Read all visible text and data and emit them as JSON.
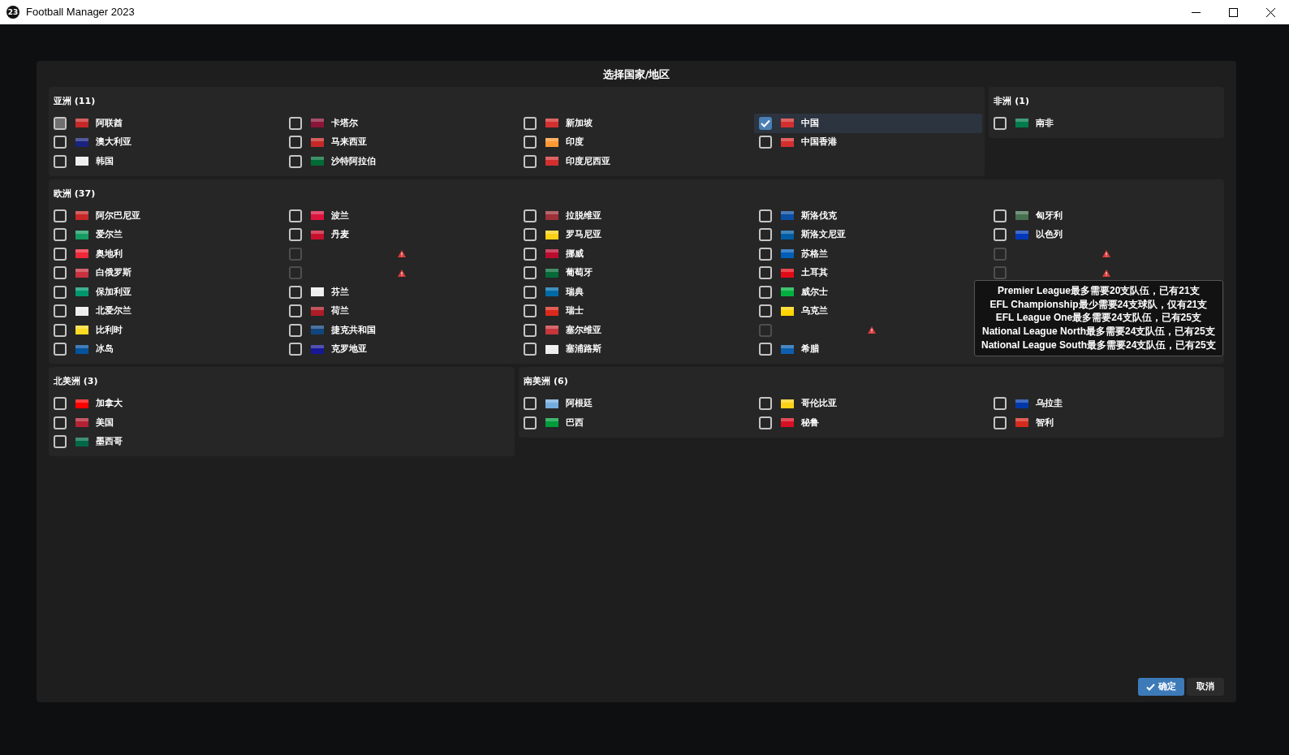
{
  "window": {
    "title": "Football Manager 2023",
    "logo": "23"
  },
  "dialog": {
    "title": "选择国家/地区",
    "rows": [
      [
        {
          "title": "亚洲 (11)",
          "columns": [
            [
              {
                "name": "阿联酋",
                "color": "#c62828",
                "checked": false,
                "hovered": true,
                "disabled": false
              },
              {
                "name": "澳大利亚",
                "color": "#1a237e",
                "checked": false,
                "hovered": false,
                "disabled": false
              },
              {
                "name": "韩国",
                "color": "#eeeeee",
                "checked": false,
                "hovered": false,
                "disabled": false
              }
            ],
            [
              {
                "name": "卡塔尔",
                "color": "#8a1538",
                "checked": false,
                "hovered": false,
                "disabled": false
              },
              {
                "name": "马来西亚",
                "color": "#c62828",
                "checked": false,
                "hovered": false,
                "disabled": false
              },
              {
                "name": "沙特阿拉伯",
                "color": "#006c35",
                "checked": false,
                "hovered": false,
                "disabled": false
              }
            ],
            [
              {
                "name": "新加坡",
                "color": "#d32f2f",
                "checked": false,
                "hovered": false,
                "disabled": false
              },
              {
                "name": "印度",
                "color": "#ff9933",
                "checked": false,
                "hovered": false,
                "disabled": false
              },
              {
                "name": "印度尼西亚",
                "color": "#d32f2f",
                "checked": false,
                "hovered": false,
                "disabled": false
              }
            ],
            [
              {
                "name": "中国",
                "color": "#d32f2f",
                "checked": true,
                "hovered": false,
                "disabled": false
              },
              {
                "name": "中国香港",
                "color": "#d32f2f",
                "checked": false,
                "hovered": false,
                "disabled": false
              }
            ]
          ]
        },
        {
          "title": "非洲 (1)",
          "columns": [
            [
              {
                "name": "南非",
                "color": "#007a4d",
                "checked": false,
                "hovered": false,
                "disabled": false
              }
            ]
          ]
        }
      ],
      [
        {
          "title": "欧洲 (37)",
          "columns": [
            [
              {
                "name": "阿尔巴尼亚",
                "color": "#c62828",
                "checked": false,
                "hovered": false,
                "disabled": false
              },
              {
                "name": "爱尔兰",
                "color": "#169b62",
                "checked": false,
                "hovered": false,
                "disabled": false
              },
              {
                "name": "奥地利",
                "color": "#ed2939",
                "checked": false,
                "hovered": false,
                "disabled": false
              },
              {
                "name": "白俄罗斯",
                "color": "#c8313e",
                "checked": false,
                "hovered": false,
                "disabled": false
              },
              {
                "name": "保加利亚",
                "color": "#00966e",
                "checked": false,
                "hovered": false,
                "disabled": false
              },
              {
                "name": "北爱尔兰",
                "color": "#eeeeee",
                "checked": false,
                "hovered": false,
                "disabled": false
              },
              {
                "name": "比利时",
                "color": "#fdda24",
                "checked": false,
                "hovered": false,
                "disabled": false
              },
              {
                "name": "冰岛",
                "color": "#02529c",
                "checked": false,
                "hovered": false,
                "disabled": false
              }
            ],
            [
              {
                "name": "波兰",
                "color": "#dc143c",
                "checked": false,
                "hovered": false,
                "disabled": false
              },
              {
                "name": "丹麦",
                "color": "#c8102e",
                "checked": false,
                "hovered": false,
                "disabled": false
              },
              {
                "checked": false,
                "hovered": false,
                "disabled": true
              },
              {
                "checked": false,
                "hovered": false,
                "disabled": true
              },
              {
                "name": "芬兰",
                "color": "#eeeeee",
                "checked": false,
                "hovered": false,
                "disabled": false
              },
              {
                "name": "荷兰",
                "color": "#ae1c28",
                "checked": false,
                "hovered": false,
                "disabled": false
              },
              {
                "name": "捷克共和国",
                "color": "#11457e",
                "checked": false,
                "hovered": false,
                "disabled": false
              },
              {
                "name": "克罗地亚",
                "color": "#171796",
                "checked": false,
                "hovered": false,
                "disabled": false
              }
            ],
            [
              {
                "name": "拉脱维亚",
                "color": "#9e3039",
                "checked": false,
                "hovered": false,
                "disabled": false
              },
              {
                "name": "罗马尼亚",
                "color": "#fcd116",
                "checked": false,
                "hovered": false,
                "disabled": false
              },
              {
                "name": "挪威",
                "color": "#ba0c2f",
                "checked": false,
                "hovered": false,
                "disabled": false
              },
              {
                "name": "葡萄牙",
                "color": "#046a38",
                "checked": false,
                "hovered": false,
                "disabled": false
              },
              {
                "name": "瑞典",
                "color": "#006aa7",
                "checked": false,
                "hovered": false,
                "disabled": false
              },
              {
                "name": "瑞士",
                "color": "#da291c",
                "checked": false,
                "hovered": false,
                "disabled": false
              },
              {
                "name": "塞尔维亚",
                "color": "#c6363c",
                "checked": false,
                "hovered": false,
                "disabled": false
              },
              {
                "name": "塞浦路斯",
                "color": "#eeeeee",
                "checked": false,
                "hovered": false,
                "disabled": false
              }
            ],
            [
              {
                "name": "斯洛伐克",
                "color": "#0b4ea2",
                "checked": false,
                "hovered": false,
                "disabled": false
              },
              {
                "name": "斯洛文尼亚",
                "color": "#005da4",
                "checked": false,
                "hovered": false,
                "disabled": false
              },
              {
                "name": "苏格兰",
                "color": "#005eb8",
                "checked": false,
                "hovered": false,
                "disabled": false
              },
              {
                "name": "土耳其",
                "color": "#e30a17",
                "checked": false,
                "hovered": false,
                "disabled": false
              },
              {
                "name": "威尔士",
                "color": "#00b140",
                "checked": false,
                "hovered": false,
                "disabled": false
              },
              {
                "name": "乌克兰",
                "color": "#ffd500",
                "checked": false,
                "hovered": false,
                "disabled": false
              },
              {
                "checked": false,
                "hovered": false,
                "disabled": true
              },
              {
                "name": "希腊",
                "color": "#0d5eaf",
                "checked": false,
                "hovered": false,
                "disabled": false
              }
            ],
            [
              {
                "name": "匈牙利",
                "color": "#477050",
                "checked": false,
                "hovered": false,
                "disabled": false
              },
              {
                "name": "以色列",
                "color": "#0038b8",
                "checked": false,
                "hovered": false,
                "disabled": false
              },
              {
                "checked": false,
                "hovered": false,
                "disabled": true
              },
              {
                "checked": false,
                "hovered": false,
                "disabled": true
              }
            ]
          ]
        }
      ],
      [
        {
          "title": "北美洲 (3)",
          "columns": [
            [
              {
                "name": "加拿大",
                "color": "#ff0000",
                "checked": false,
                "hovered": false,
                "disabled": false
              },
              {
                "name": "美国",
                "color": "#b22234",
                "checked": false,
                "hovered": false,
                "disabled": false
              },
              {
                "name": "墨西哥",
                "color": "#006847",
                "checked": false,
                "hovered": false,
                "disabled": false
              }
            ]
          ]
        },
        {
          "title": "南美洲 (6)",
          "columns": [
            [
              {
                "name": "阿根廷",
                "color": "#74acdf",
                "checked": false,
                "hovered": false,
                "disabled": false
              },
              {
                "name": "巴西",
                "color": "#009c3b",
                "checked": false,
                "hovered": false,
                "disabled": false
              }
            ],
            [
              {
                "name": "哥伦比亚",
                "color": "#fcd116",
                "checked": false,
                "hovered": false,
                "disabled": false
              },
              {
                "name": "秘鲁",
                "color": "#d91023",
                "checked": false,
                "hovered": false,
                "disabled": false
              }
            ],
            [
              {
                "name": "乌拉圭",
                "color": "#0038a8",
                "checked": false,
                "hovered": false,
                "disabled": false
              },
              {
                "name": "智利",
                "color": "#d52b1e",
                "checked": false,
                "hovered": false,
                "disabled": false
              }
            ]
          ]
        }
      ]
    ],
    "buttons": [
      {
        "label": "确定",
        "kind": "primary"
      },
      {
        "label": "取消",
        "kind": "secondary"
      }
    ]
  },
  "tooltip": {
    "lines": [
      "Premier League最多需要20支队伍，已有21支",
      "EFL Championship最少需要24支球队，仅有21支",
      "EFL League One最多需要24支队伍，已有25支",
      "National League North最多需要24支队伍，已有25支",
      "National League South最多需要24支队伍，已有25支"
    ]
  }
}
